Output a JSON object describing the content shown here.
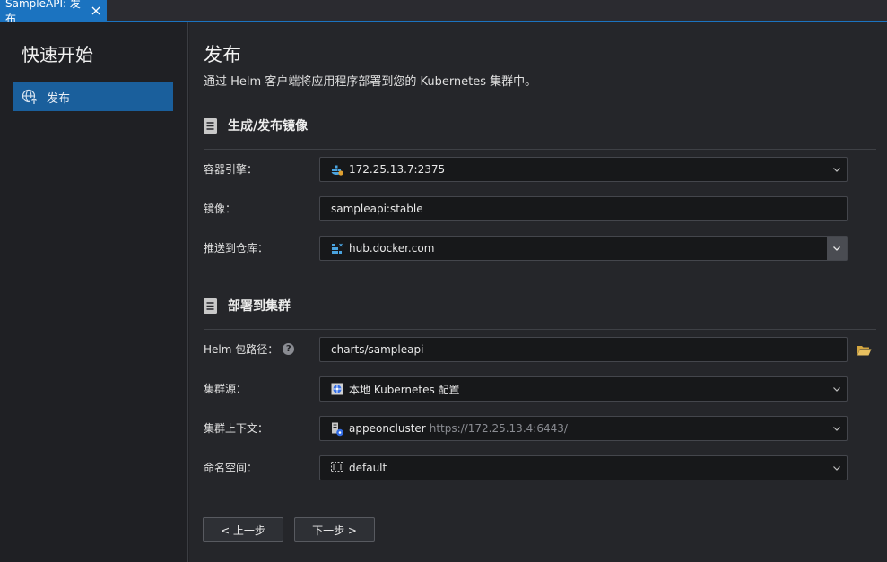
{
  "tab": {
    "title": "SampleAPI: 发布"
  },
  "sidebar": {
    "title": "快速开始",
    "items": [
      {
        "label": "发布",
        "icon": "globe-upload-icon"
      }
    ]
  },
  "main": {
    "title": "发布",
    "subtitle": "通过 Helm 客户端将应用程序部署到您的 Kubernetes 集群中。",
    "sections": [
      {
        "title": "生成/发布镜像",
        "fields": [
          {
            "label": "容器引擎：",
            "value": "172.25.13.7:2375",
            "icon": "docker-engine-icon",
            "type": "dropdown"
          },
          {
            "label": "镜像：",
            "value": "sampleapi:stable",
            "type": "text"
          },
          {
            "label": "推送到仓库：",
            "value": "hub.docker.com",
            "icon": "registry-icon",
            "type": "dropdown"
          }
        ]
      },
      {
        "title": "部署到集群",
        "fields": [
          {
            "label": "Helm 包路径：",
            "value": "charts/sampleapi",
            "type": "text",
            "help": "?"
          },
          {
            "label": "集群源：",
            "value": "本地 Kubernetes 配置",
            "icon": "kubernetes-icon",
            "type": "dropdown"
          },
          {
            "label": "集群上下文：",
            "value": "appeoncluster",
            "secondary": "https://172.25.13.4:6443/",
            "icon": "cluster-icon",
            "type": "dropdown"
          },
          {
            "label": "命名空间：",
            "value": "default",
            "icon": "namespace-icon",
            "type": "dropdown"
          }
        ]
      }
    ],
    "buttons": {
      "back": "< 上一步",
      "next": "下一步 >"
    }
  },
  "colors": {
    "accent": "#1b73c0",
    "selected": "#1a5f9c",
    "background": "#25262a"
  }
}
